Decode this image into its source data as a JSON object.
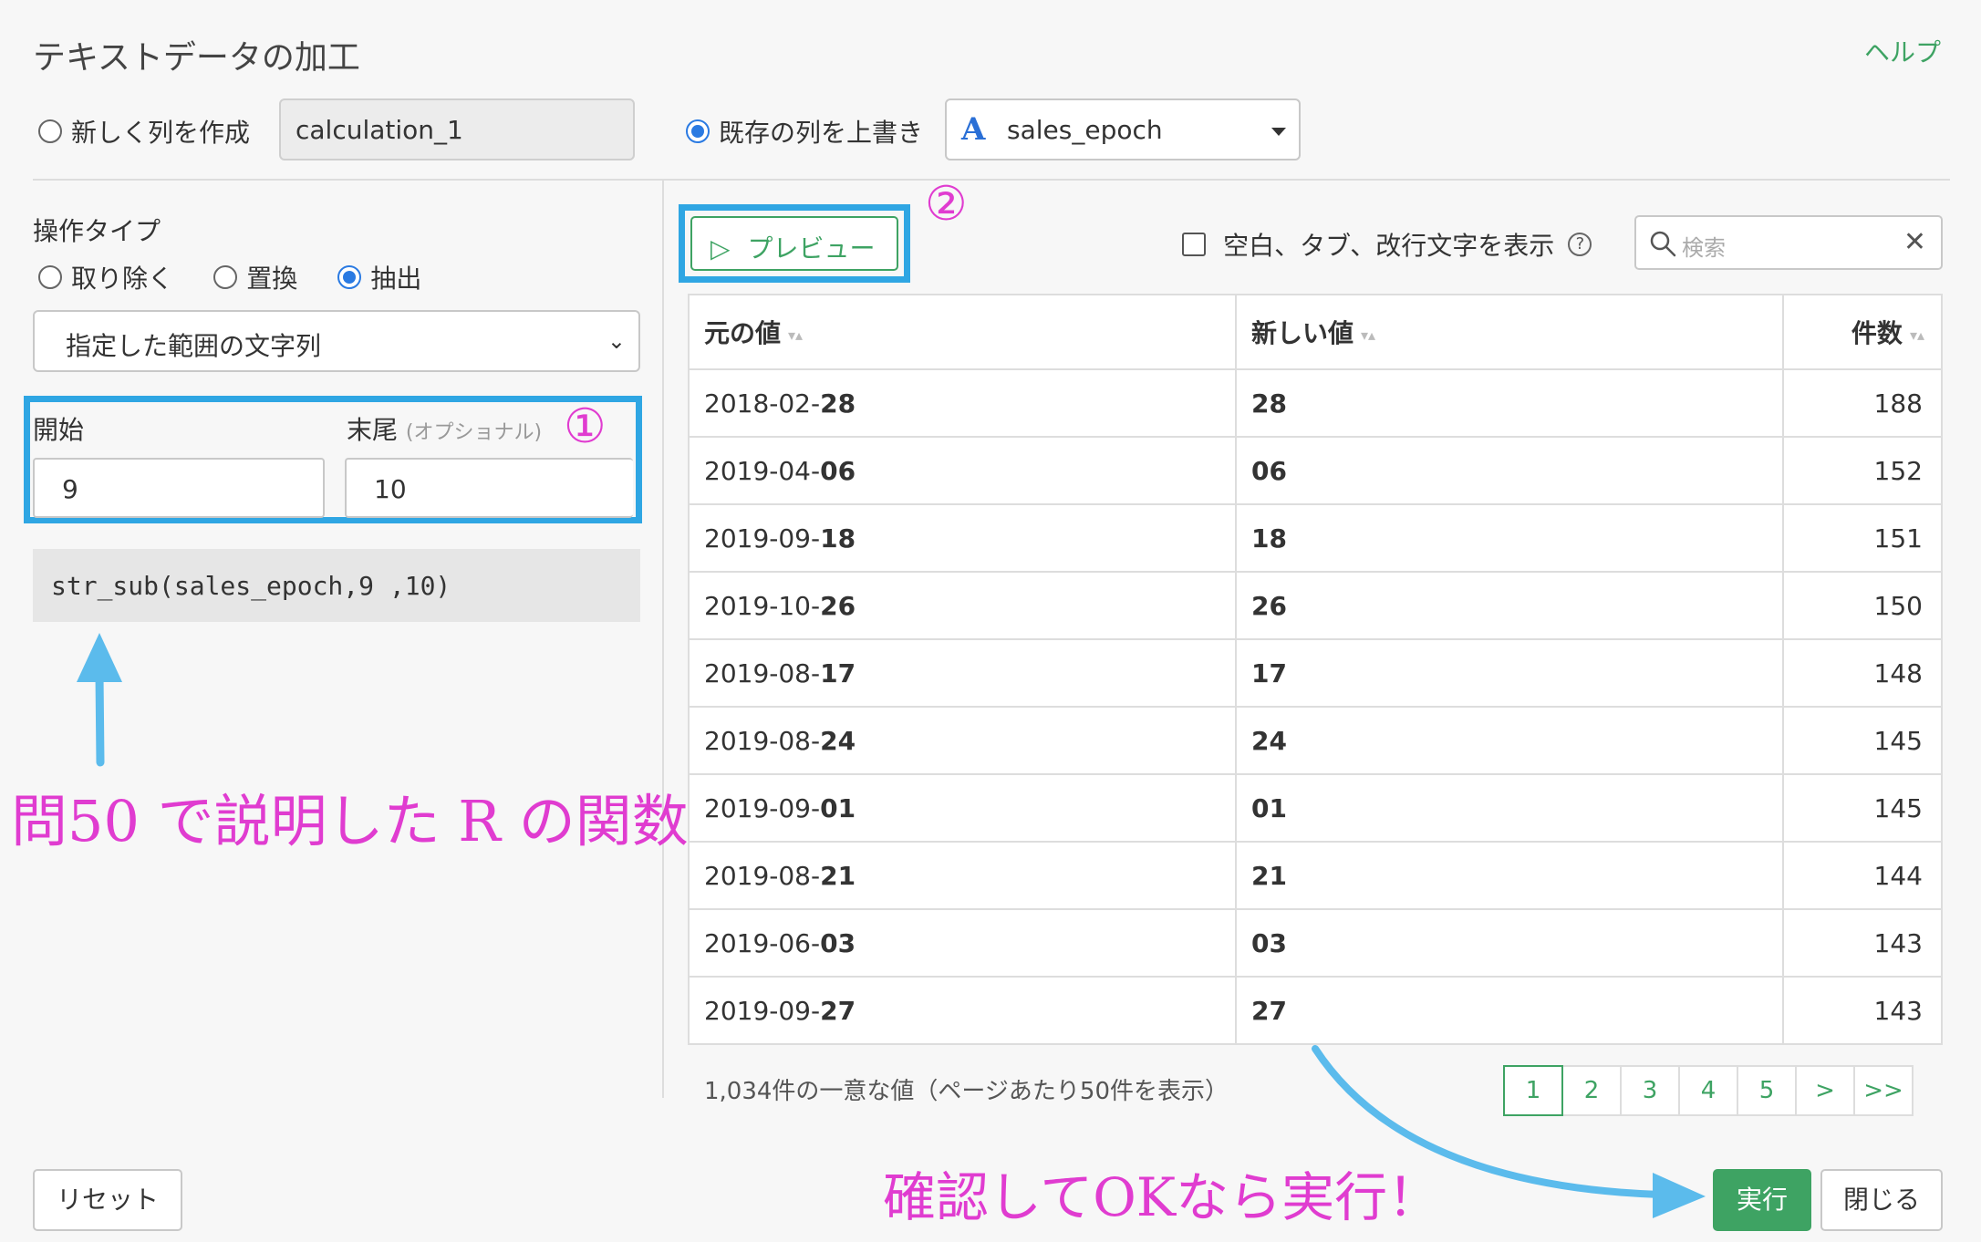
{
  "dialog": {
    "title": "テキストデータの加工",
    "help": "ヘルプ"
  },
  "target": {
    "new_col_label": "新しく列を作成",
    "new_col_value": "calculation_1",
    "overwrite_label": "既存の列を上書き",
    "column_type_icon": "A",
    "column_name": "sales_epoch"
  },
  "operation": {
    "label": "操作タイプ",
    "types": [
      "取り除く",
      "置換",
      "抽出"
    ],
    "selected_type": "抽出",
    "mode": "指定した範囲の文字列",
    "start_label": "開始",
    "end_label": "末尾",
    "end_optional": "(オプショナル)",
    "start_value": "9",
    "end_value": "10",
    "code": "str_sub(sales_epoch,9 ,10)"
  },
  "annotations": {
    "marker1": "①",
    "marker2": "②",
    "function_note": "問50 で説明した R の関数",
    "run_note": "確認してOKなら実行！"
  },
  "preview": {
    "button_label": "プレビュー",
    "whitespace_label": "空白、タブ、改行文字を表示",
    "search_placeholder": "検索"
  },
  "table": {
    "headers": [
      "元の値",
      "新しい値",
      "件数"
    ],
    "rows": [
      {
        "prefix": "2018-02-",
        "bold": "28",
        "new": "28",
        "count": "188"
      },
      {
        "prefix": "2019-04-",
        "bold": "06",
        "new": "06",
        "count": "152"
      },
      {
        "prefix": "2019-09-",
        "bold": "18",
        "new": "18",
        "count": "151"
      },
      {
        "prefix": "2019-10-",
        "bold": "26",
        "new": "26",
        "count": "150"
      },
      {
        "prefix": "2019-08-",
        "bold": "17",
        "new": "17",
        "count": "148"
      },
      {
        "prefix": "2019-08-",
        "bold": "24",
        "new": "24",
        "count": "145"
      },
      {
        "prefix": "2019-09-",
        "bold": "01",
        "new": "01",
        "count": "145"
      },
      {
        "prefix": "2019-08-",
        "bold": "21",
        "new": "21",
        "count": "144"
      },
      {
        "prefix": "2019-06-",
        "bold": "03",
        "new": "03",
        "count": "143"
      },
      {
        "prefix": "2019-09-",
        "bold": "27",
        "new": "27",
        "count": "143"
      }
    ]
  },
  "summary": "1,034件の一意な値（ページあたり50件を表示）",
  "pagination": [
    "1",
    "2",
    "3",
    "4",
    "5",
    ">",
    ">>"
  ],
  "footer": {
    "reset": "リセット",
    "run": "実行",
    "close": "閉じる"
  },
  "colors": {
    "accent_green": "#3ea363",
    "highlight_blue": "#2fa6e3",
    "annotation_magenta": "#e03cd0",
    "radio_blue": "#2a7ae2"
  }
}
